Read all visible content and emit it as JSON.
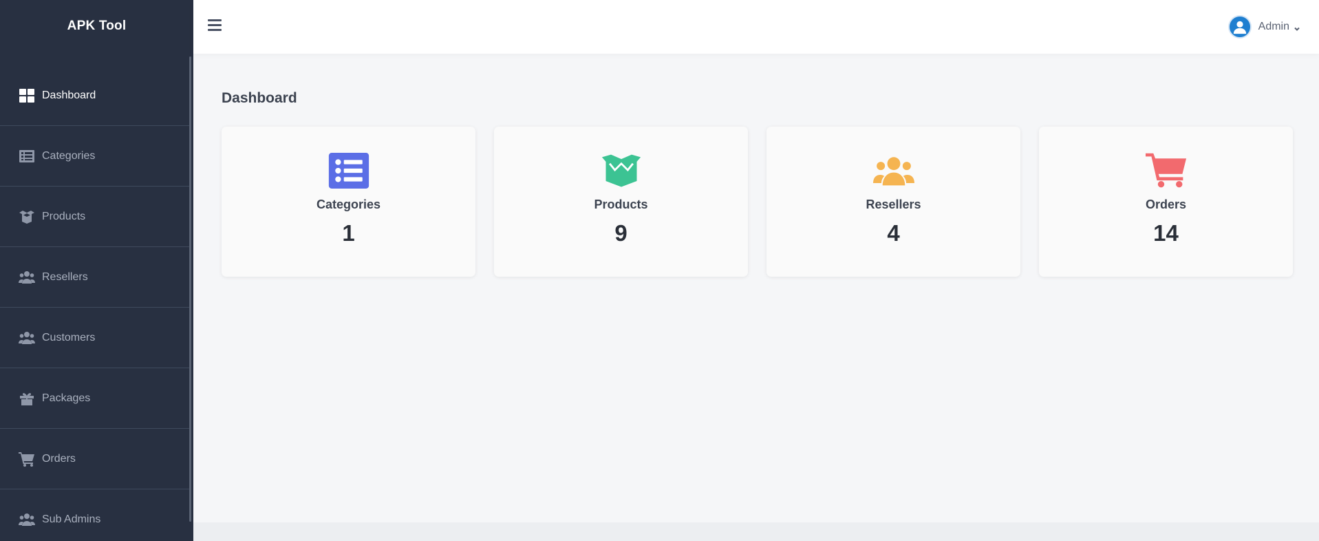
{
  "app": {
    "title": "APK Tool"
  },
  "sidebar": {
    "items": [
      {
        "label": "Dashboard",
        "icon": "grid-icon",
        "active": true
      },
      {
        "label": "Categories",
        "icon": "list-icon"
      },
      {
        "label": "Products",
        "icon": "box-icon"
      },
      {
        "label": "Resellers",
        "icon": "users-icon"
      },
      {
        "label": "Customers",
        "icon": "users-icon"
      },
      {
        "label": "Packages",
        "icon": "gift-icon"
      },
      {
        "label": "Orders",
        "icon": "cart-icon"
      },
      {
        "label": "Sub Admins",
        "icon": "users-icon"
      }
    ]
  },
  "header": {
    "user_name": "Admin"
  },
  "main": {
    "title": "Dashboard",
    "cards": [
      {
        "label": "Categories",
        "value": "1",
        "icon": "list-icon",
        "color": "#5b6ee6"
      },
      {
        "label": "Products",
        "value": "9",
        "icon": "box-icon",
        "color": "#3cc393"
      },
      {
        "label": "Resellers",
        "value": "4",
        "icon": "users-icon",
        "color": "#f5b451"
      },
      {
        "label": "Orders",
        "value": "14",
        "icon": "cart-icon",
        "color": "#f26a6e"
      }
    ]
  },
  "colors": {
    "sidebar_bg": "#283041",
    "page_bg": "#f5f6f8",
    "accent_blue": "#1f7fd0"
  }
}
